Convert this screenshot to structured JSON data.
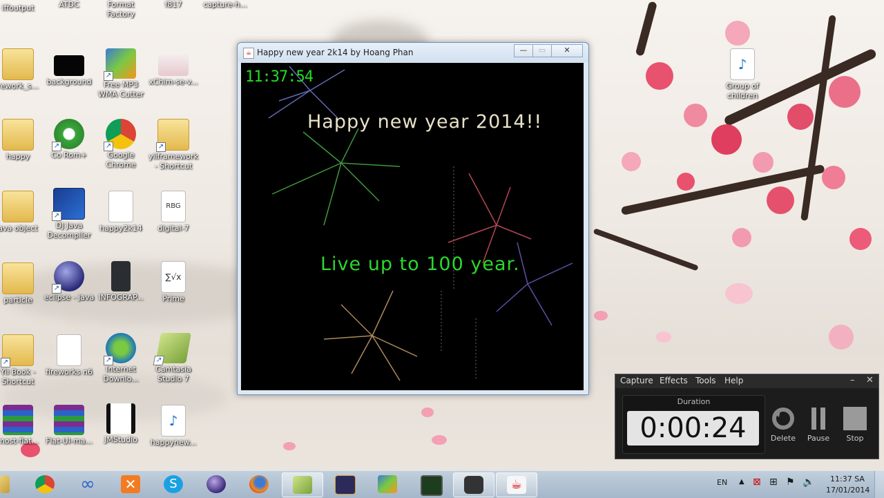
{
  "desktop": {
    "icons": [
      {
        "label": "iffoutput"
      },
      {
        "label": "ATDC"
      },
      {
        "label": "Format Factory"
      },
      {
        "label": "f817"
      },
      {
        "label": "capture-h..."
      },
      {
        "label": "rework_s..."
      },
      {
        "label": "background"
      },
      {
        "label": "Free MP3 WMA Cutter"
      },
      {
        "label": "xChim-se-v..."
      },
      {
        "label": "happy"
      },
      {
        "label": "Co Rom+"
      },
      {
        "label": "Google Chrome"
      },
      {
        "label": "yiiframework - Shortcut"
      },
      {
        "label": "ava object"
      },
      {
        "label": "DJ Java Decompiler"
      },
      {
        "label": "happy2k14"
      },
      {
        "label": "digital-7"
      },
      {
        "label": "particle"
      },
      {
        "label": "eclipse - java"
      },
      {
        "label": "INFOGRAP..."
      },
      {
        "label": "Prime"
      },
      {
        "label": "Yii Book - Shortcut"
      },
      {
        "label": "fireworks n6"
      },
      {
        "label": "Internet Downlo..."
      },
      {
        "label": "Camtasia Studio 7"
      },
      {
        "label": "most-flat..."
      },
      {
        "label": "Flat-UI-ma..."
      },
      {
        "label": "JMStudio"
      },
      {
        "label": "happynew..."
      },
      {
        "label": "Group of children"
      }
    ]
  },
  "app_window": {
    "title": "Happy new year 2k14 by Hoang Phan",
    "clock": "11:37:54",
    "message_1": "Happy new year 2014!!",
    "message_2": "Live up to 100 year."
  },
  "recorder": {
    "menu": [
      "Capture",
      "Effects",
      "Tools",
      "Help"
    ],
    "duration_label": "Duration",
    "duration_value": "0:00:24",
    "buttons": {
      "delete": "Delete",
      "pause": "Pause",
      "stop": "Stop"
    }
  },
  "taskbar": {
    "language": "EN",
    "time": "11:37 SA",
    "date": "17/01/2014"
  }
}
